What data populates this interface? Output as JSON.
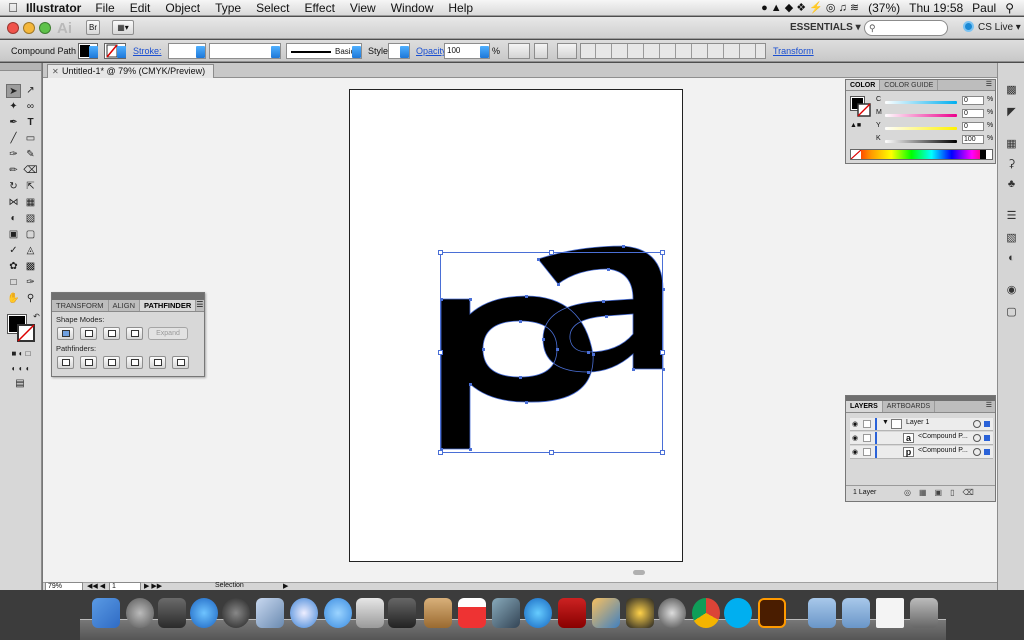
{
  "menubar": {
    "app_name": "Illustrator",
    "items": [
      "File",
      "Edit",
      "Object",
      "Type",
      "Select",
      "Effect",
      "View",
      "Window",
      "Help"
    ],
    "battery": "(37%)",
    "clock": "Thu 19:58",
    "user": "Paul"
  },
  "appbar": {
    "logo": "Ai",
    "bridge": "Br",
    "workspace": "ESSENTIALS",
    "search_placeholder": "",
    "cs_live": "CS Live"
  },
  "controlbar": {
    "selection_type": "Compound Path",
    "stroke_label": "Stroke:",
    "brush_label": "Basic",
    "style_label": "Style:",
    "opacity_label": "Opacity:",
    "opacity_value": "100",
    "opacity_unit": "%",
    "transform_label": "Transform"
  },
  "document": {
    "tab_title": "Untitled-1* @ 79% (CMYK/Preview)",
    "zoom": "79%",
    "artboard_number": "1",
    "status": "Selection"
  },
  "pathfinder": {
    "tabs": [
      "TRANSFORM",
      "ALIGN",
      "PATHFINDER"
    ],
    "shape_modes_label": "Shape Modes:",
    "expand_label": "Expand",
    "pathfinders_label": "Pathfinders:"
  },
  "color_panel": {
    "tabs": [
      "COLOR",
      "COLOR GUIDE"
    ],
    "channels": [
      {
        "letter": "C",
        "value": "0",
        "unit": "%"
      },
      {
        "letter": "M",
        "value": "0",
        "unit": "%"
      },
      {
        "letter": "Y",
        "value": "0",
        "unit": "%"
      },
      {
        "letter": "K",
        "value": "100",
        "unit": "%"
      }
    ]
  },
  "layers_panel": {
    "tabs": [
      "LAYERS",
      "ARTBOARDS"
    ],
    "rows": [
      {
        "name": "Layer 1"
      },
      {
        "name": "<Compound P..."
      },
      {
        "name": "<Compound P..."
      }
    ],
    "layer_count": "1 Layer"
  },
  "colors": {
    "selection_blue": "#4a6fd6",
    "accent_blue": "#1e78d8"
  }
}
